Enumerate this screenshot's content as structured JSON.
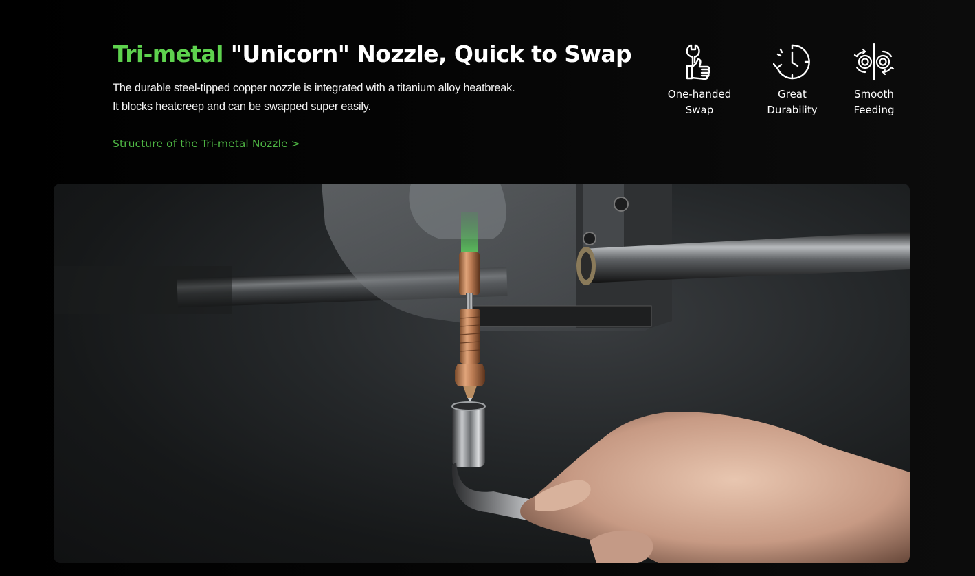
{
  "headline": {
    "accent": "Tri-metal",
    "rest": " \"Unicorn\" Nozzle, Quick to Swap"
  },
  "description": {
    "line1": "The durable steel-tipped copper nozzle is integrated with a titanium alloy heatbreak.",
    "line2": "It blocks heatcreep and can be swapped super easily."
  },
  "link": {
    "label": "Structure of the Tri-metal Nozzle >"
  },
  "features": [
    {
      "icon": "thumbs-up-wrench-icon",
      "line1": "One-handed",
      "line2": "Swap"
    },
    {
      "icon": "clock-durability-icon",
      "line1": "Great",
      "line2": "Durability"
    },
    {
      "icon": "feeding-gears-icon",
      "line1": "Smooth",
      "line2": "Feeding"
    }
  ],
  "colors": {
    "accent": "#5ed24e",
    "link": "#4eb544",
    "background": "#000000",
    "text": "#ffffff"
  }
}
